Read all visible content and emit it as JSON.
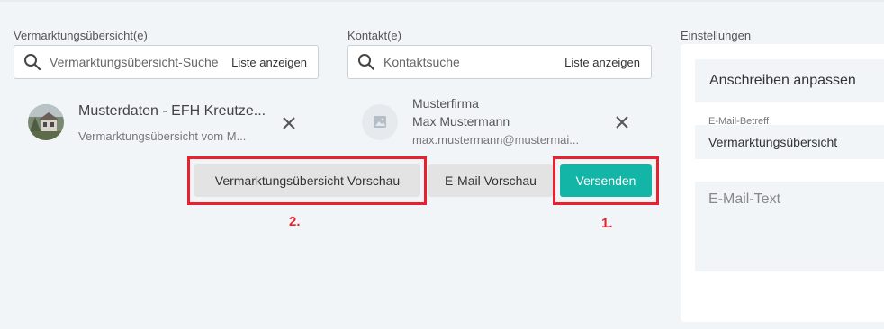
{
  "left_column": {
    "label": "Vermarktungsübersicht(e)",
    "search": {
      "placeholder": "Vermarktungsübersicht-Suche",
      "list_label": "Liste anzeigen"
    },
    "selected": {
      "title": "Musterdaten - EFH Kreutze...",
      "subtitle": "Vermarktungsübersicht vom M..."
    }
  },
  "middle_column": {
    "label": "Kontakt(e)",
    "search": {
      "placeholder": "Kontaktsuche",
      "list_label": "Liste anzeigen"
    },
    "selected": {
      "company": "Musterfirma",
      "name": "Max Mustermann",
      "email": "max.mustermann@mustermai..."
    }
  },
  "actions": {
    "preview_overview": "Vermarktungsübersicht Vorschau",
    "preview_email": "E-Mail Vorschau",
    "send": "Versenden"
  },
  "annotations": {
    "step_send": "1.",
    "step_preview": "2.",
    "color": "#e8212e"
  },
  "settings": {
    "label": "Einstellungen",
    "customize": "Anschreiben anpassen",
    "subject_label": "E-Mail-Betreff",
    "subject_value": "Vermarktungsübersicht",
    "body_placeholder": "E-Mail-Text"
  },
  "colors": {
    "accent": "#12b5a6",
    "background": "#f1f5f8",
    "annotation": "#e8212e"
  },
  "icons": [
    "search-icon",
    "close-icon",
    "image-placeholder-icon"
  ]
}
